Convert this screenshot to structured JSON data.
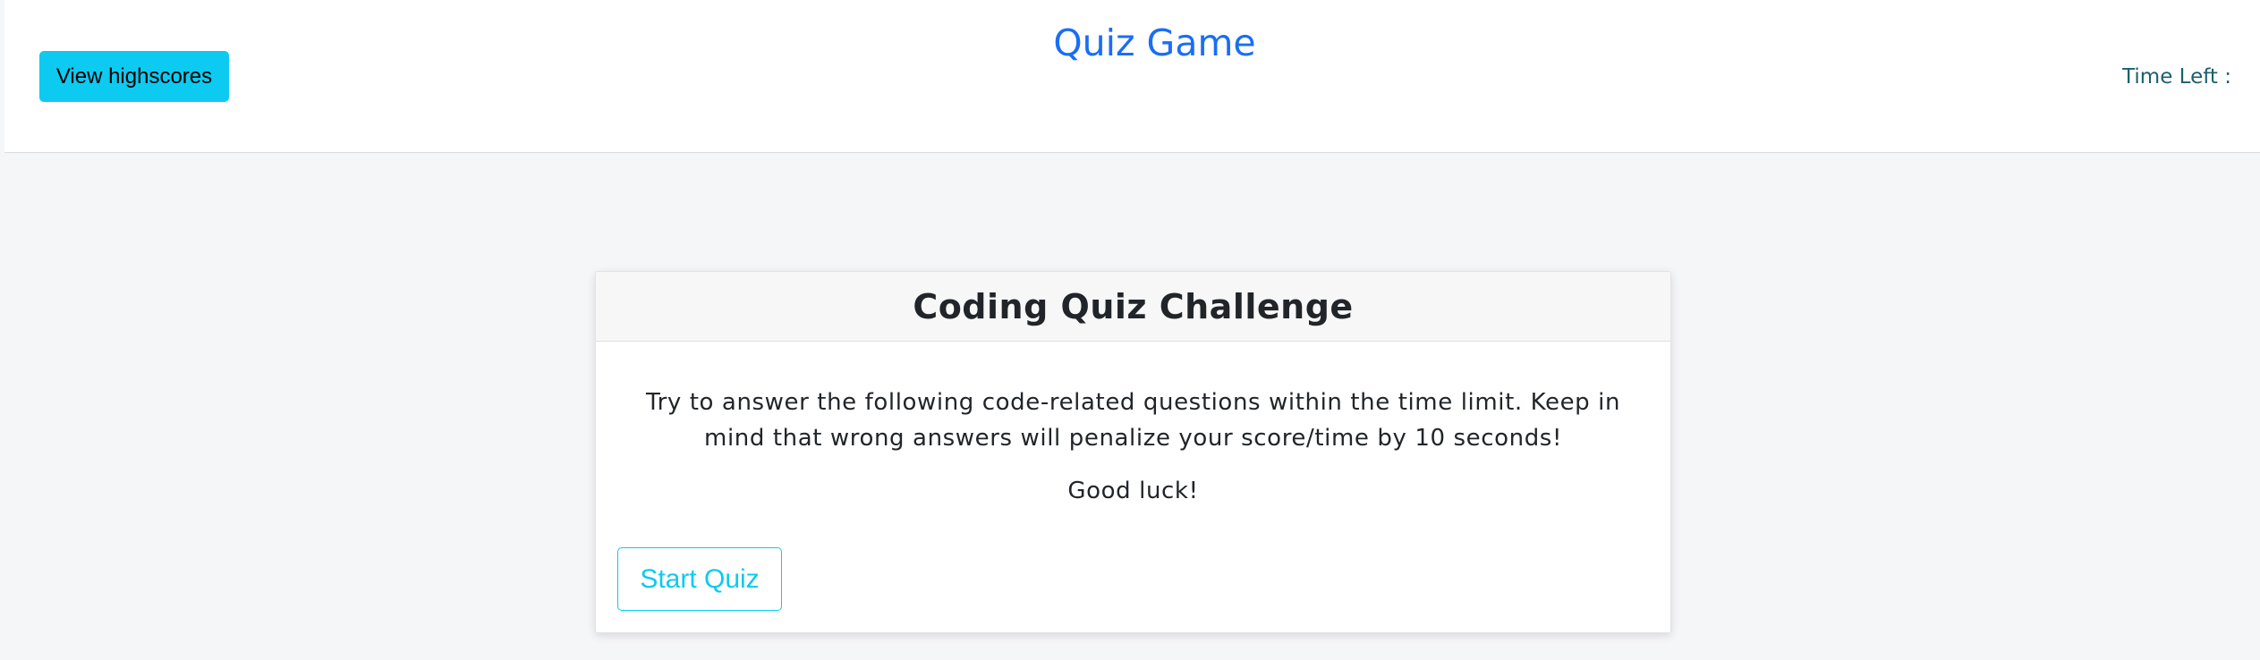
{
  "header": {
    "highscores_label": "View highscores",
    "title": "Quiz Game",
    "time_left_label": "Time Left :",
    "time_left_value": ""
  },
  "card": {
    "title": "Coding Quiz Challenge",
    "instructions": "Try to answer the following code-related questions within the time limit. Keep in mind that wrong answers will penalize your score/time by 10 seconds!",
    "good_luck": "Good luck!",
    "start_label": "Start Quiz"
  },
  "colors": {
    "page_background": "#f5f6f8",
    "title_blue": "#1a6ef5",
    "info_button": "#0dcaf0",
    "time_text": "#1c5f6e",
    "body_text": "#212529"
  }
}
